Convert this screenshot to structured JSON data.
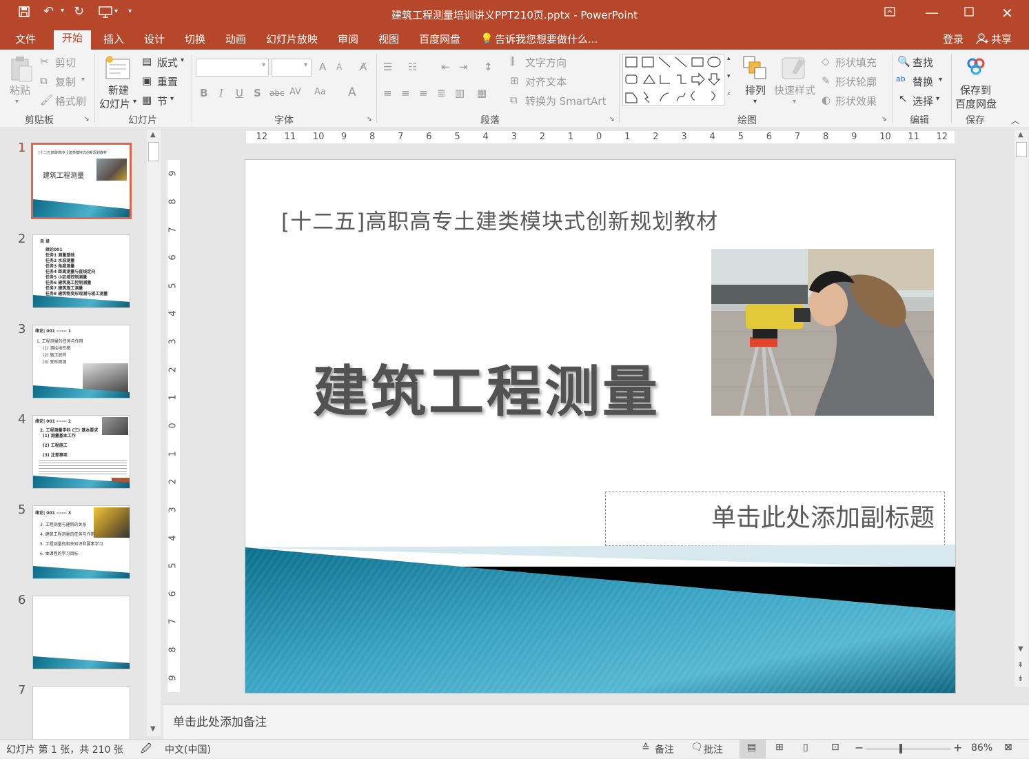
{
  "window": {
    "title": "建筑工程测量培训讲义PPT210页.pptx - PowerPoint"
  },
  "colors": {
    "accent": "#b7472a",
    "ribbon_bg": "#f3f3f3",
    "slide_teal": "#1e8aa6"
  },
  "tabs": [
    "文件",
    "开始",
    "插入",
    "设计",
    "切换",
    "动画",
    "幻灯片放映",
    "审阅",
    "视图",
    "百度网盘"
  ],
  "tellme": "告诉我您想要做什么...",
  "account": {
    "login": "登录",
    "share": "共享"
  },
  "ribbon": {
    "clipboard": {
      "paste": "粘贴",
      "cut": "剪切",
      "copy": "复制",
      "format_painter": "格式刷",
      "label": "剪贴板"
    },
    "slides": {
      "new_slide_line1": "新建",
      "new_slide_line2": "幻灯片",
      "layout": "版式",
      "reset": "重置",
      "section": "节",
      "label": "幻灯片"
    },
    "font": {
      "label": "字体",
      "bold": "B",
      "italic": "I",
      "underline": "U",
      "shadow": "S",
      "strike": "abc",
      "spacing": "AV",
      "case": "Aa",
      "color": "A",
      "grow": "A",
      "shrink": "A"
    },
    "paragraph": {
      "text_direction": "文字方向",
      "align_text": "对齐文本",
      "smartart": "转换为 SmartArt",
      "label": "段落"
    },
    "drawing": {
      "arrange": "排列",
      "quick_styles": "快速样式",
      "fill": "形状填充",
      "outline": "形状轮廓",
      "effects": "形状效果",
      "label": "绘图"
    },
    "editing": {
      "find": "查找",
      "replace": "替换",
      "select": "选择",
      "label": "编辑"
    },
    "save": {
      "line1": "保存到",
      "line2": "百度网盘",
      "label": "保存"
    }
  },
  "ruler": {
    "h": [
      "12",
      "11",
      "10",
      "9",
      "8",
      "7",
      "6",
      "5",
      "4",
      "3",
      "2",
      "1",
      "0",
      "1",
      "2",
      "3",
      "4",
      "5",
      "6",
      "7",
      "8",
      "9",
      "10",
      "11",
      "12"
    ],
    "v": [
      "9",
      "8",
      "7",
      "6",
      "5",
      "4",
      "3",
      "2",
      "1",
      "0",
      "1",
      "2",
      "3",
      "4",
      "5",
      "6",
      "7",
      "8",
      "9"
    ]
  },
  "thumbnails": [
    {
      "num": "1",
      "title": "建筑工程测量",
      "header": "[十二五]高职高专土建类模块式创新规划教材"
    },
    {
      "num": "2",
      "title": "目 录",
      "lines": [
        "绪论001",
        "任务1  测量基础",
        "任务2  水准测量",
        "任务3  角度测量",
        "任务4  距离测量与直线定向",
        "任务5  小区域控制测量",
        "任务6  建筑施工控制测量",
        "任务7  建筑施工测量",
        "任务8  建筑物变形观测与竣工测量"
      ]
    },
    {
      "num": "3",
      "title": "绪论| 001 ------ 1",
      "lines": [
        "1. 工程测量的任务与作用",
        "(1) 测绘地形图",
        "(2) 施工放样",
        "(3) 变形观测"
      ]
    },
    {
      "num": "4",
      "title": "绪论| 001 ------ 2",
      "lines": [
        "2. 工程测量学科 (三) 基本要求",
        "(1) 测量基本工作",
        "(2) 工程施工",
        "(3) 注意事项"
      ]
    },
    {
      "num": "5",
      "title": "绪论| 001 ------ 3",
      "lines": [
        "3. 工程测量与建筑的关系",
        "4. 建筑工程测量的任务与作用",
        "5. 工程测量的相关知识和要素学习",
        "6. 本课程的学习目标"
      ]
    },
    {
      "num": "6"
    },
    {
      "num": "7"
    }
  ],
  "slide": {
    "header": "[十二五]高职高专土建类模块式创新规划教材",
    "title": "建筑工程测量",
    "subtitle_placeholder": "单击此处添加副标题"
  },
  "notes_placeholder": "单击此处添加备注",
  "status": {
    "slide_info": "幻灯片 第 1 张，共 210 张",
    "language": "中文(中国)",
    "notes": "备注",
    "comments": "批注",
    "zoom": "86%"
  }
}
